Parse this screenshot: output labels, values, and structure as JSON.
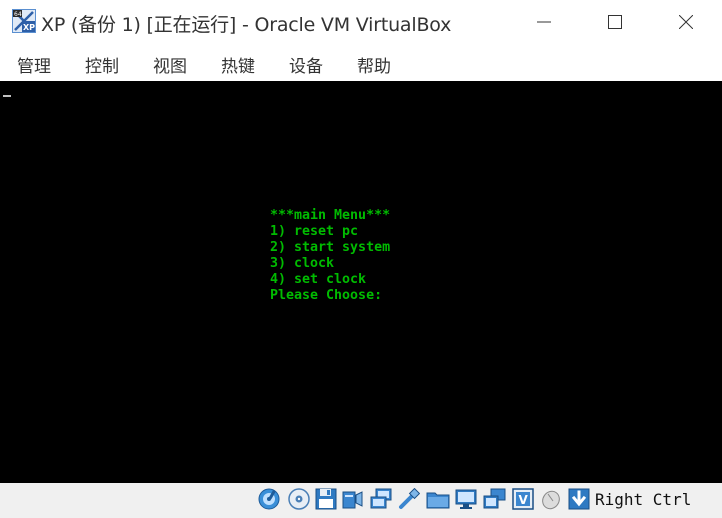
{
  "window": {
    "title": "XP (备份 1) [正在运行] - Oracle VM VirtualBox"
  },
  "menu": {
    "items": [
      "管理",
      "控制",
      "视图",
      "热键",
      "设备",
      "帮助"
    ]
  },
  "console": {
    "lines": [
      "***main Menu***",
      "1) reset pc",
      "2) start system",
      "3) clock",
      "4) set clock",
      "Please Choose:"
    ],
    "text_color": "#00bb00",
    "background": "#000000"
  },
  "statusbar": {
    "icons": [
      "hard-disk-icon",
      "optical-drive-icon",
      "floppy-drive-icon",
      "audio-icon",
      "network-icon",
      "usb-icon",
      "shared-folders-icon",
      "display-icon",
      "video-capture-icon",
      "virtualization-icon",
      "mouse-integration-icon",
      "keyboard-capture-icon"
    ],
    "host_key": "Right Ctrl"
  }
}
